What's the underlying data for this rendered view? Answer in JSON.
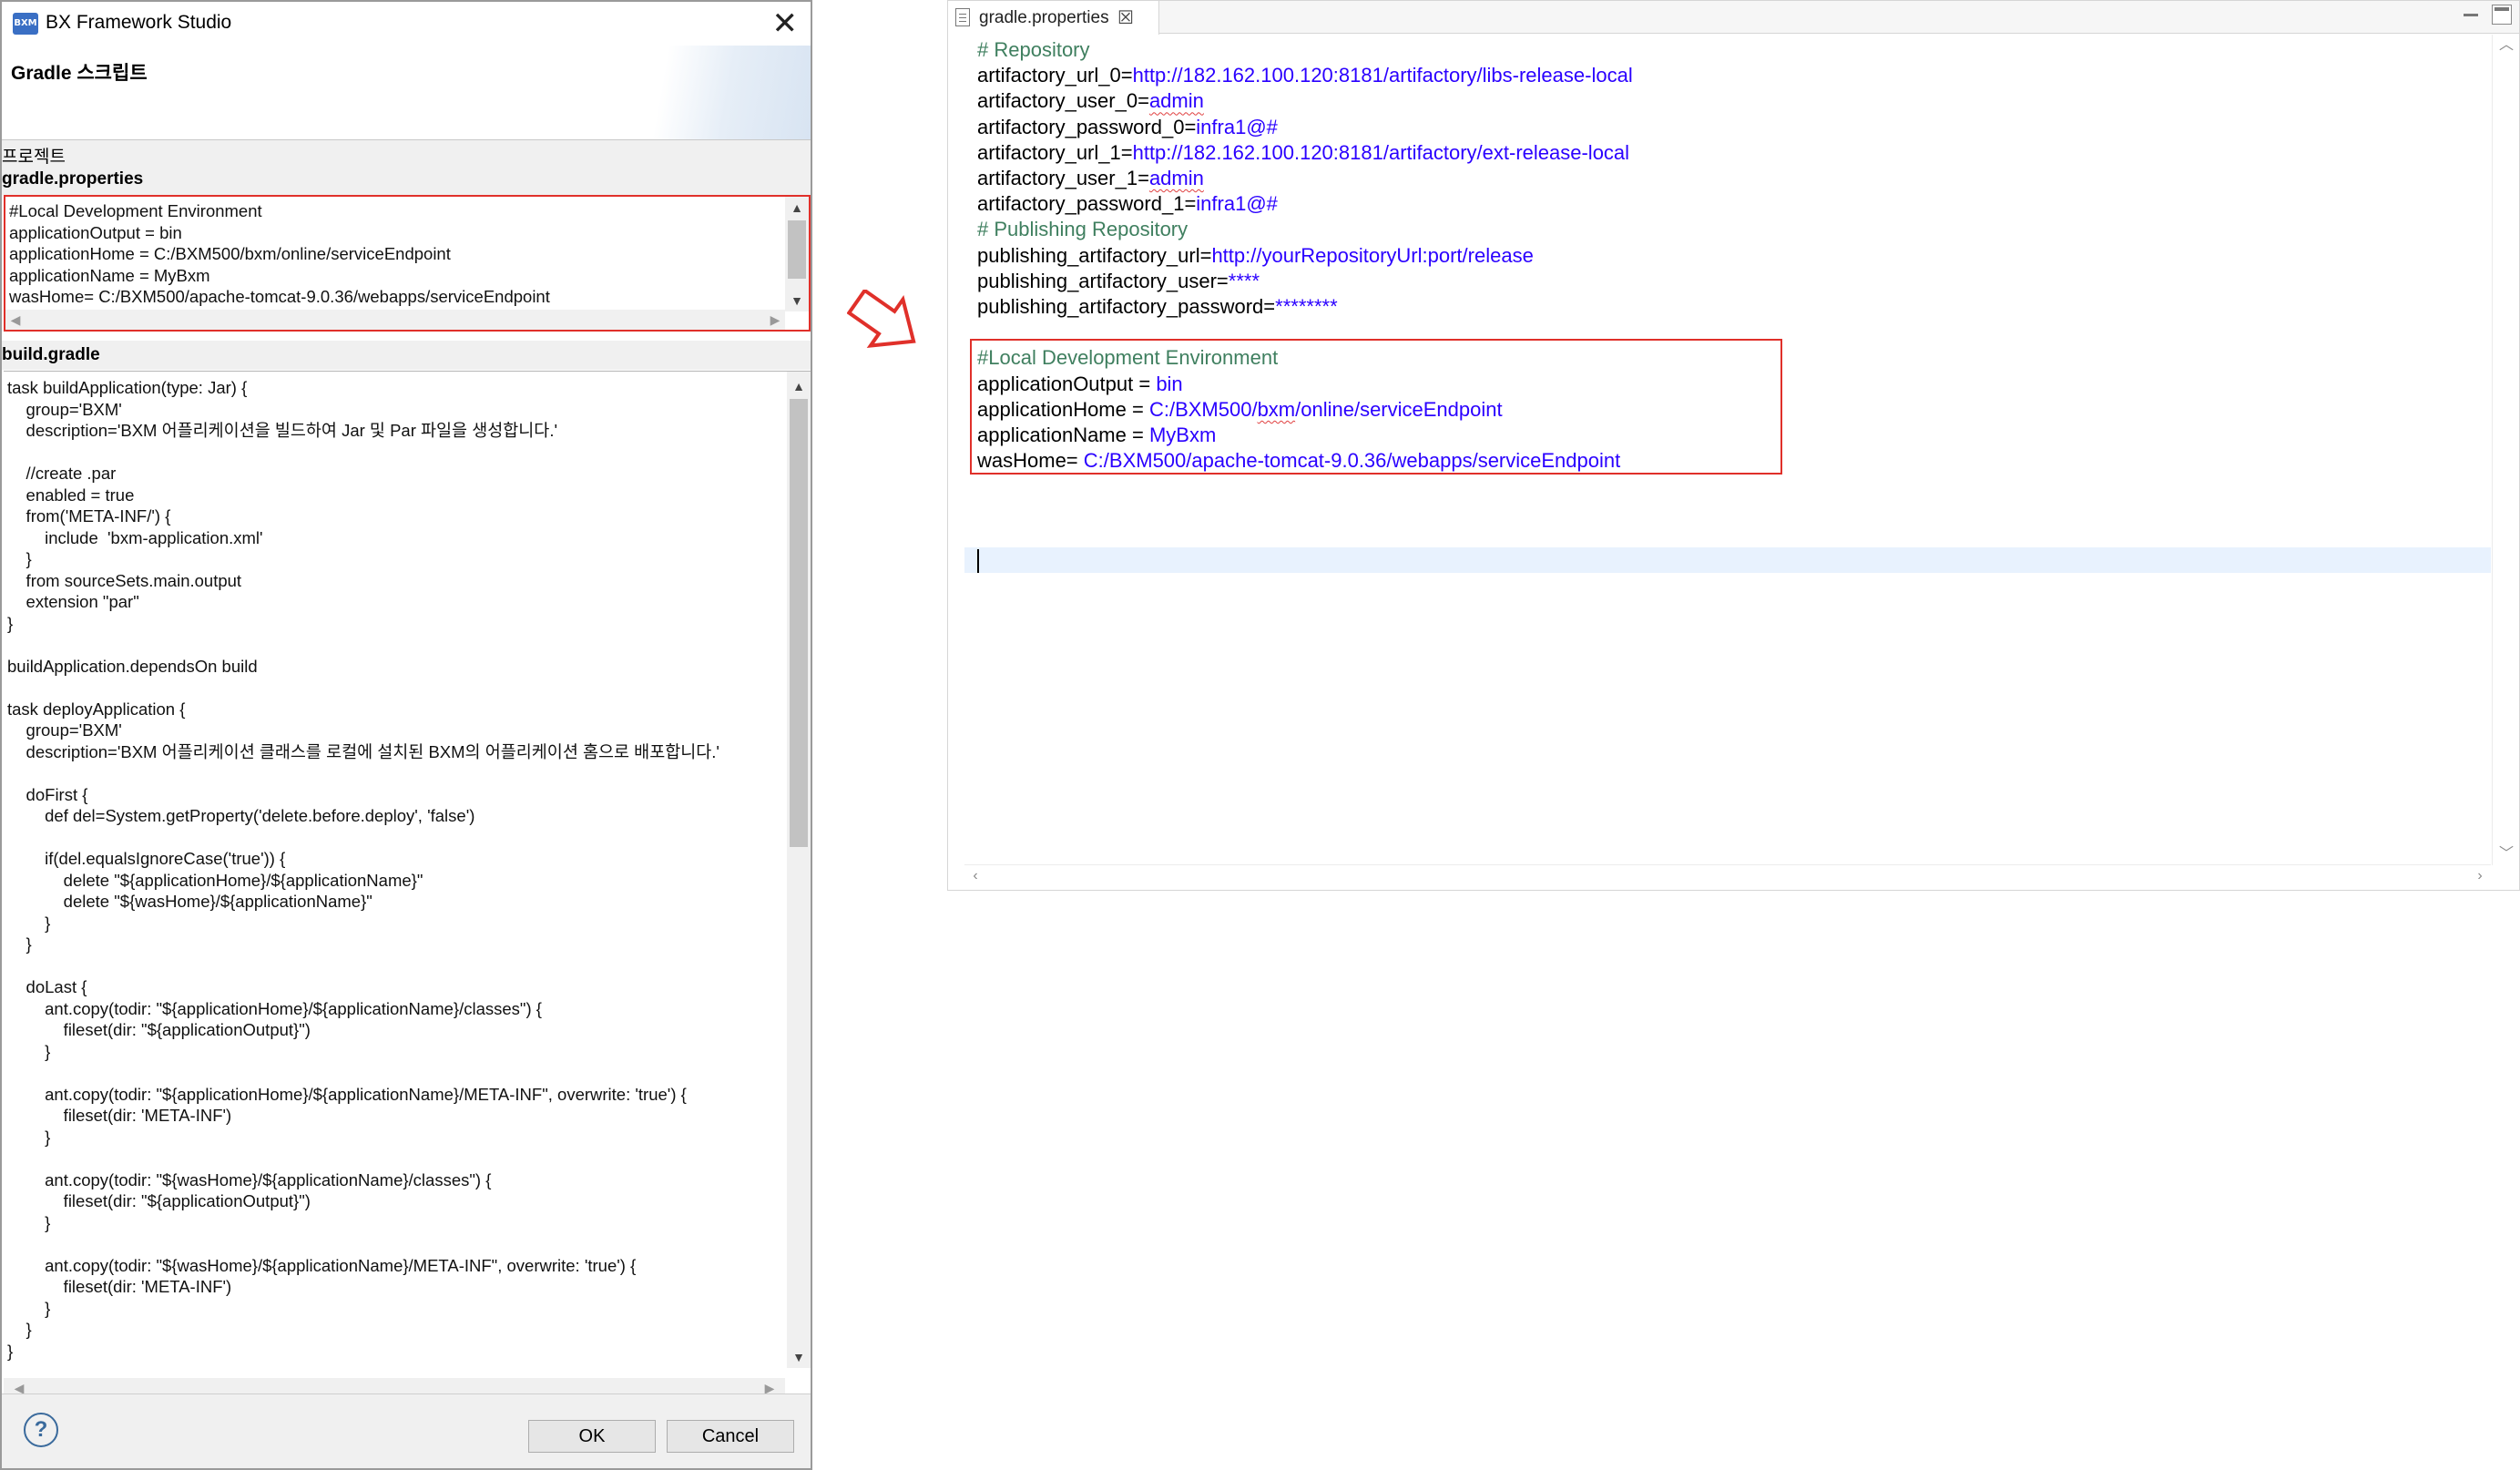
{
  "dialog": {
    "app_icon_text": "BXM",
    "window_title": "BX Framework Studio",
    "close_glyph": "✕",
    "header_title": "Gradle 스크립트",
    "project_label": "프로젝트",
    "gradle_properties_label": "gradle.properties",
    "build_gradle_label": "build.gradle",
    "gradle_properties_lines": [
      "#Local Development Environment",
      "applicationOutput = bin",
      "applicationHome = C:/BXM500/bxm/online/serviceEndpoint",
      "applicationName = MyBxm",
      "wasHome= C:/BXM500/apache-tomcat-9.0.36/webapps/serviceEndpoint"
    ],
    "build_gradle_lines": [
      "task buildApplication(type: Jar) {",
      "    group='BXM'",
      "    description='BXM 어플리케이션을 빌드하여 Jar 및 Par 파일을 생성합니다.'",
      "",
      "    //create .par",
      "    enabled = true",
      "    from('META-INF/') {",
      "        include  'bxm-application.xml'",
      "    }",
      "    from sourceSets.main.output",
      "    extension \"par\"",
      "}",
      "",
      "buildApplication.dependsOn build",
      "",
      "task deployApplication {",
      "    group='BXM'",
      "    description='BXM 어플리케이션 클래스를 로컬에 설치된 BXM의 어플리케이션 홈으로 배포합니다.'",
      "",
      "    doFirst {",
      "        def del=System.getProperty('delete.before.deploy', 'false')",
      "",
      "        if(del.equalsIgnoreCase('true')) {",
      "            delete \"${applicationHome}/${applicationName}\"",
      "            delete \"${wasHome}/${applicationName}\"",
      "        }",
      "    }",
      "",
      "    doLast {",
      "        ant.copy(todir: \"${applicationHome}/${applicationName}/classes\") {",
      "            fileset(dir: \"${applicationOutput}\")",
      "        }",
      "",
      "        ant.copy(todir: \"${applicationHome}/${applicationName}/META-INF\", overwrite: 'true') {",
      "            fileset(dir: 'META-INF')",
      "        }",
      "",
      "        ant.copy(todir: \"${wasHome}/${applicationName}/classes\") {",
      "            fileset(dir: \"${applicationOutput}\")",
      "        }",
      "",
      "        ant.copy(todir: \"${wasHome}/${applicationName}/META-INF\", overwrite: 'true') {",
      "            fileset(dir: 'META-INF')",
      "        }",
      "    }",
      "}"
    ],
    "help_glyph": "?",
    "ok_label": "OK",
    "cancel_label": "Cancel"
  },
  "editor": {
    "tab_label": "gradle.properties",
    "tab_close_glyph": "☒",
    "lines": [
      [
        {
          "t": "# Repository",
          "c": "c"
        }
      ],
      [
        {
          "t": "artifactory_url_0=",
          "c": "k"
        },
        {
          "t": "http://182.162.100.120:8181/artifactory/libs-release-local",
          "c": "v"
        }
      ],
      [
        {
          "t": "artifactory_user_0=",
          "c": "k"
        },
        {
          "t": "admin",
          "c": "v",
          "sq": true
        }
      ],
      [
        {
          "t": "artifactory_password_0=",
          "c": "k"
        },
        {
          "t": "infra1@#",
          "c": "v"
        }
      ],
      [
        {
          "t": "artifactory_url_1=",
          "c": "k"
        },
        {
          "t": "http://182.162.100.120:8181/artifactory/ext-release-local",
          "c": "v"
        }
      ],
      [
        {
          "t": "artifactory_user_1=",
          "c": "k"
        },
        {
          "t": "admin",
          "c": "v",
          "sq": true
        }
      ],
      [
        {
          "t": "artifactory_password_1=",
          "c": "k"
        },
        {
          "t": "infra1@#",
          "c": "v"
        }
      ],
      [
        {
          "t": "# Publishing Repository",
          "c": "c"
        }
      ],
      [
        {
          "t": "publishing_artifactory_url=",
          "c": "k"
        },
        {
          "t": "http://yourRepositoryUrl:port/release",
          "c": "v"
        }
      ],
      [
        {
          "t": "publishing_artifactory_user=",
          "c": "k"
        },
        {
          "t": "****",
          "c": "v"
        }
      ],
      [
        {
          "t": "publishing_artifactory_password=",
          "c": "k"
        },
        {
          "t": "********",
          "c": "v"
        }
      ],
      [],
      [
        {
          "t": "#Local Development Environment",
          "c": "c"
        }
      ],
      [
        {
          "t": "applicationOutput = ",
          "c": "k"
        },
        {
          "t": "bin",
          "c": "v"
        }
      ],
      [
        {
          "t": "applicationHome = ",
          "c": "k"
        },
        {
          "t": "C:/BXM500/",
          "c": "v"
        },
        {
          "t": "bxm",
          "c": "v",
          "sq": true
        },
        {
          "t": "/online/serviceEndpoint",
          "c": "v"
        }
      ],
      [
        {
          "t": "applicationName = ",
          "c": "k"
        },
        {
          "t": "MyBxm",
          "c": "v"
        }
      ],
      [
        {
          "t": "wasHome= ",
          "c": "k"
        },
        {
          "t": "C:/BXM500/apache-tomcat-9.0.36/webapps/serviceEndpoint",
          "c": "v"
        }
      ]
    ]
  },
  "colors": {
    "highlight_frame": "#e0302a",
    "key_text": "#000000",
    "value_text": "#2a00ff",
    "comment_text": "#3f7f5f",
    "current_line": "#e8f2fe"
  }
}
